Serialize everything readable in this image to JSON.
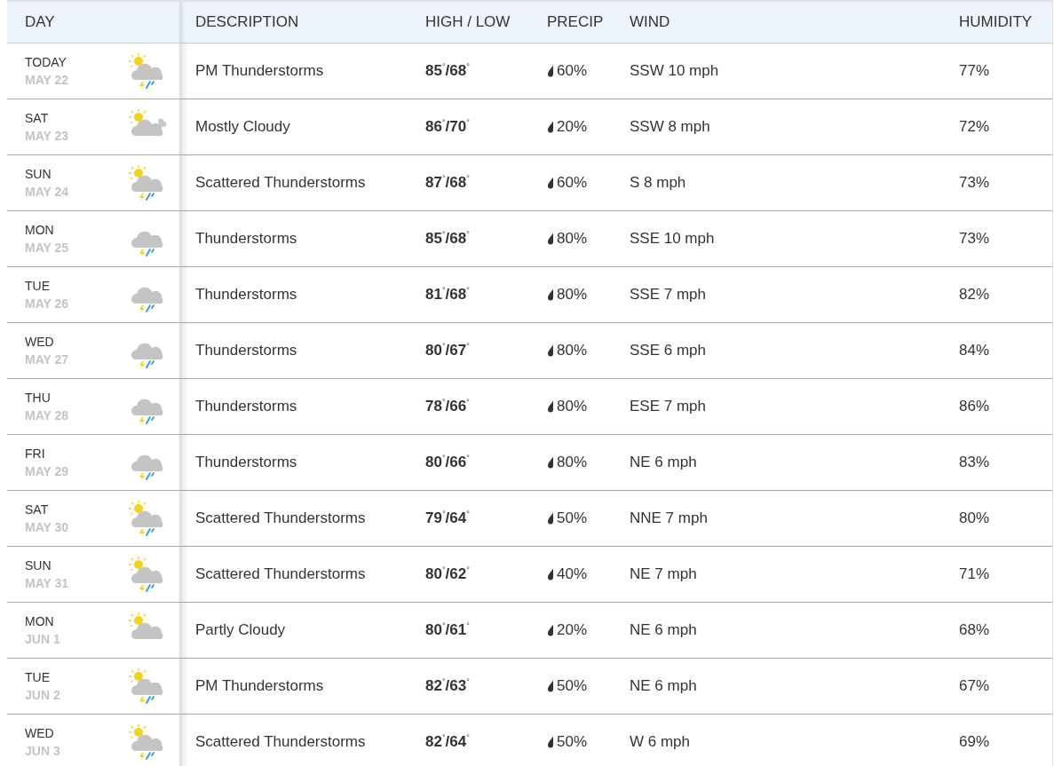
{
  "columns": [
    "DAY",
    "DESCRIPTION",
    "HIGH / LOW",
    "PRECIP",
    "WIND",
    "HUMIDITY"
  ],
  "rows": [
    {
      "day": "TODAY",
      "date": "MAY 22",
      "kind": "sun_storm",
      "description": "PM Thunderstorms",
      "high_low": "85$^{°}$/68$^{°}$",
      "precip": "60%",
      "wind": "SSW 10 mph",
      "humidity": "77%"
    },
    {
      "day": "SAT",
      "date": "MAY 23",
      "kind": "mostly_cloudy",
      "description": "Mostly Cloudy",
      "high_low": "86$^{°}$/70$^{°}$",
      "precip": "20%",
      "wind": "SSW 8 mph",
      "humidity": "72%"
    },
    {
      "day": "SUN",
      "date": "MAY 24",
      "kind": "sun_storm",
      "description": "Scattered Thunderstorms",
      "high_low": "87$^{°}$/68$^{°}$",
      "precip": "60%",
      "wind": "S 8 mph",
      "humidity": "73%"
    },
    {
      "day": "MON",
      "date": "MAY 25",
      "kind": "storm",
      "description": "Thunderstorms",
      "high_low": "85$^{°}$/68$^{°}$",
      "precip": "80%",
      "wind": "SSE 10 mph",
      "humidity": "73%"
    },
    {
      "day": "TUE",
      "date": "MAY 26",
      "kind": "storm",
      "description": "Thunderstorms",
      "high_low": "81$^{°}$/68$^{°}$",
      "precip": "80%",
      "wind": "SSE 7 mph",
      "humidity": "82%"
    },
    {
      "day": "WED",
      "date": "MAY 27",
      "kind": "storm",
      "description": "Thunderstorms",
      "high_low": "80$^{°}$/67$^{°}$",
      "precip": "80%",
      "wind": "SSE 6 mph",
      "humidity": "84%"
    },
    {
      "day": "THU",
      "date": "MAY 28",
      "kind": "storm",
      "description": "Thunderstorms",
      "high_low": "78$^{°}$/66$^{°}$",
      "precip": "80%",
      "wind": "ESE 7 mph",
      "humidity": "86%"
    },
    {
      "day": "FRI",
      "date": "MAY 29",
      "kind": "storm",
      "description": "Thunderstorms",
      "high_low": "80$^{°}$/66$^{°}$",
      "precip": "80%",
      "wind": "NE 6 mph",
      "humidity": "83%"
    },
    {
      "day": "SAT",
      "date": "MAY 30",
      "kind": "sun_storm",
      "description": "Scattered Thunderstorms",
      "high_low": "79$^{°}$/64$^{°}$",
      "precip": "50%",
      "wind": "NNE 7 mph",
      "humidity": "80%"
    },
    {
      "day": "SUN",
      "date": "MAY 31",
      "kind": "sun_storm",
      "description": "Scattered Thunderstorms",
      "high_low": "80$^{°}$/62$^{°}$",
      "precip": "40%",
      "wind": "NE 7 mph",
      "humidity": "71%"
    },
    {
      "day": "MON",
      "date": "JUN 1",
      "kind": "partly_cloudy",
      "description": "Partly Cloudy",
      "high_low": "80$^{°}$/61$^{°}$",
      "precip": "20%",
      "wind": "NE 6 mph",
      "humidity": "68%"
    },
    {
      "day": "TUE",
      "date": "JUN 2",
      "kind": "sun_storm",
      "description": "PM Thunderstorms",
      "high_low": "82$^{°}$/63$^{°}$",
      "precip": "50%",
      "wind": "NE 6 mph",
      "humidity": "67%"
    },
    {
      "day": "WED",
      "date": "JUN 3",
      "kind": "sun_storm",
      "description": "Scattered Thunderstorms",
      "high_low": "82$^{°}$/64$^{°}$",
      "precip": "50%",
      "wind": "W 6 mph",
      "humidity": "69%"
    }
  ]
}
